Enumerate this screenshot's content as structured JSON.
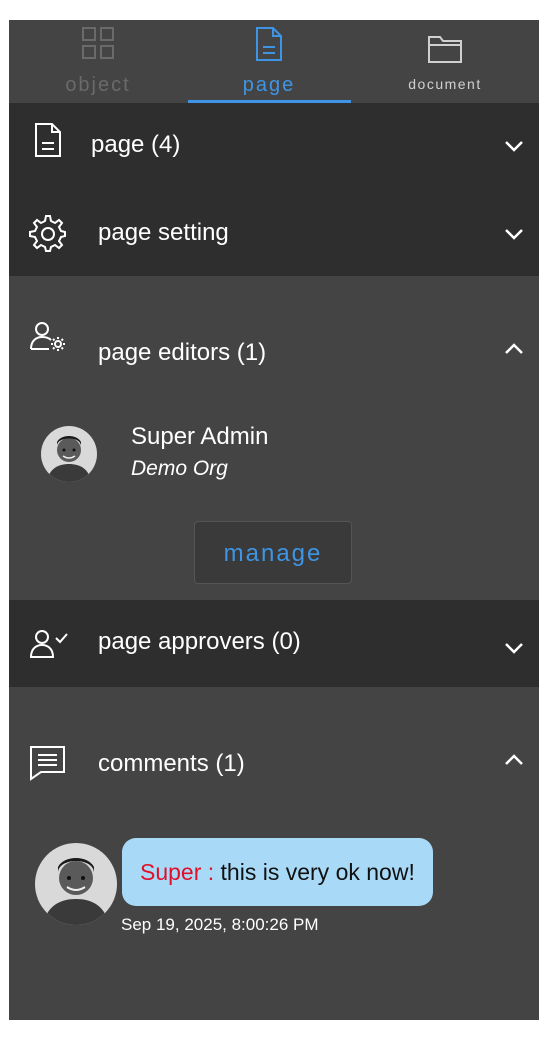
{
  "tabs": [
    {
      "label": "object",
      "icon": "grid-icon",
      "active": false
    },
    {
      "label": "page",
      "icon": "page-icon",
      "active": true
    },
    {
      "label": "document",
      "icon": "folder-icon",
      "active": false
    }
  ],
  "sections": {
    "page": {
      "title": "page (4)",
      "icon": "document-icon",
      "expanded": false
    },
    "page_setting": {
      "title": "page setting",
      "icon": "gear-icon",
      "expanded": false
    },
    "page_editors": {
      "title": "page editors (1)",
      "icon": "user-gear-icon",
      "expanded": true
    },
    "page_approvers": {
      "title": "page approvers (0)",
      "icon": "user-check-icon",
      "expanded": false
    },
    "comments": {
      "title": "comments (1)",
      "icon": "comment-icon",
      "expanded": true
    }
  },
  "editors": [
    {
      "name": "Super Admin",
      "org": "Demo Org"
    }
  ],
  "manage_label": "manage",
  "comment_list": [
    {
      "author": "Super :",
      "text": "this is very ok now!",
      "timestamp": "Sep 19, 2025, 8:00:26 PM"
    }
  ],
  "colors": {
    "accent": "#3e95e5",
    "panel": "#444444",
    "section_dark": "#2e2e2e",
    "bubble": "#a8daf8",
    "author": "#e0102a"
  }
}
